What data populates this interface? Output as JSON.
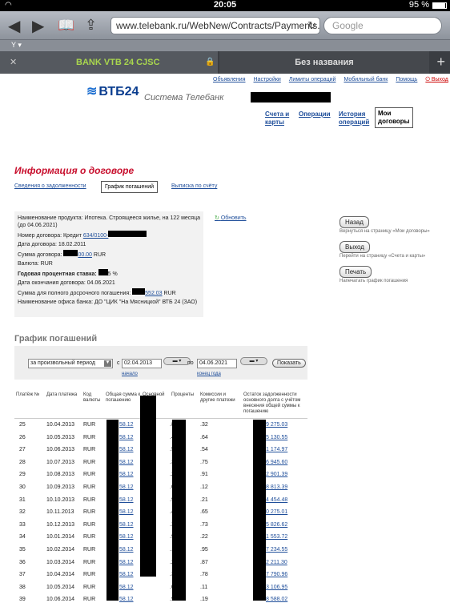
{
  "status": {
    "time": "20:05",
    "battery": "95 %"
  },
  "browser": {
    "url": "www.telebank.ru/WebNew/Contracts/Payments...",
    "search_placeholder": "Google",
    "ymenu": "Y ▾",
    "tab1": "BANK VTB 24 CJSC",
    "tab2": "Без названия"
  },
  "header": {
    "links": [
      "Объявления",
      "Настройки",
      "Лимиты операций",
      "Мобильный банк",
      "Помощь"
    ],
    "exit": "Выход",
    "logo": "ВТБ24",
    "tagline": "Система Телебанк"
  },
  "nav": {
    "items": [
      "Счета и карты",
      "Операции",
      "История операций",
      "Мои договоры"
    ]
  },
  "page_title": "Информация о договоре",
  "subtabs": [
    "Сведения о задолженности",
    "График погашений",
    "Выписка по счёту"
  ],
  "info": {
    "product": "Наименование продукта:  Ипотека. Строящееся жилье, на 122 месяца (до 04.06.2021)",
    "number_label": "Номер договора:",
    "number_prefix": "Кредит ",
    "number_link": "634/0100-",
    "date": "Дата договора:  18.02.2011",
    "sum_label": "Сумма договора:",
    "sum_value": "00.00",
    "sum_cur": "RUR",
    "currency": "Валюта:  RUR",
    "rate_label": "Годовая процентная ставка:",
    "rate_value": "5 %",
    "end": "Дата окончания договора:  04.06.2021",
    "full_label": "Сумма для полного досрочного погашения:",
    "full_value": "552.03",
    "full_cur": "RUR",
    "office": "Наименование офиса банка:  ДО \"ЦИК \"На Мясницкой\" ВТБ 24 (ЗАО)"
  },
  "refresh": "Обновить",
  "actions": [
    {
      "label": "Назад",
      "hint": "Вернуться на страницу «Мои договоры»"
    },
    {
      "label": "Выход",
      "hint": "Перейти на страницу «Счета и карты»"
    },
    {
      "label": "Печать",
      "hint": "Напечатать график погашения"
    }
  ],
  "schedule": {
    "title": "График погашений",
    "period": "за произвольный период",
    "from_label": "с",
    "from": "02.04.2013",
    "to_label": "по",
    "to": "04.06.2021",
    "start_link": "начало",
    "end_link": "конец года",
    "show": "Показать",
    "columns": [
      "Платёж №",
      "Дата платежа",
      "Код валюты",
      "Общая сумма к погашению",
      "Основной долг",
      "Проценты",
      "Комиссии и другие платежи",
      "Остаток задолженности основного долга с учётом внесения общей суммы к погашению"
    ],
    "rows": [
      {
        "n": "25",
        "date": "10.04.2013",
        "cur": "RUR",
        "total": "58.12",
        "main": ".80",
        "pct": ".32",
        "rest": "9 275.03"
      },
      {
        "n": "26",
        "date": "10.05.2013",
        "cur": "RUR",
        "total": "58.12",
        "main": ".48",
        "pct": ".64",
        "rest": "5 130.55"
      },
      {
        "n": "27",
        "date": "10.06.2013",
        "cur": "RUR",
        "total": "58.12",
        "main": ".58",
        "pct": ".54",
        "rest": "1 174.97"
      },
      {
        "n": "28",
        "date": "10.07.2013",
        "cur": "RUR",
        "total": "58.12",
        "main": ".37",
        "pct": ".75",
        "rest": "6 945.60"
      },
      {
        "n": "29",
        "date": "10.08.2013",
        "cur": "RUR",
        "total": "58.12",
        "main": ".21",
        "pct": ".91",
        "rest": "2 901.39"
      },
      {
        "n": "30",
        "date": "10.09.2013",
        "cur": "RUR",
        "total": "58.12",
        "main": ".00",
        "pct": ".12",
        "rest": "8 813.39"
      },
      {
        "n": "31",
        "date": "10.10.2013",
        "cur": "RUR",
        "total": "58.12",
        "main": ".91",
        "pct": ".21",
        "rest": "4 454.48"
      },
      {
        "n": "32",
        "date": "10.11.2013",
        "cur": "RUR",
        "total": "58.12",
        "main": ".47",
        "pct": ".65",
        "rest": "0 275.01"
      },
      {
        "n": "33",
        "date": "10.12.2013",
        "cur": "RUR",
        "total": "58.12",
        "main": ".39",
        "pct": ".73",
        "rest": "5 826.62"
      },
      {
        "n": "34",
        "date": "10.01.2014",
        "cur": "RUR",
        "total": "58.12",
        "main": ".90",
        "pct": ".22",
        "rest": "1 553.72"
      },
      {
        "n": "35",
        "date": "10.02.2014",
        "cur": "RUR",
        "total": "58.12",
        "main": ".17",
        "pct": ".95",
        "rest": "7 234.55"
      },
      {
        "n": "36",
        "date": "10.03.2014",
        "cur": "RUR",
        "total": "58.12",
        "main": ".25",
        "pct": ".87",
        "rest": "2 211.30"
      },
      {
        "n": "37",
        "date": "10.04.2014",
        "cur": "RUR",
        "total": "58.12",
        "main": ".34",
        "pct": ".78",
        "rest": "7 790.96"
      },
      {
        "n": "38",
        "date": "10.05.2014",
        "cur": "RUR",
        "total": "58.12",
        "main": ".01",
        "pct": ".11",
        "rest": "3 106.95"
      },
      {
        "n": "39",
        "date": "10.06.2014",
        "cur": "RUR",
        "total": "58.12",
        "main": ".93",
        "pct": ".19",
        "rest": "8 588.02"
      }
    ]
  }
}
